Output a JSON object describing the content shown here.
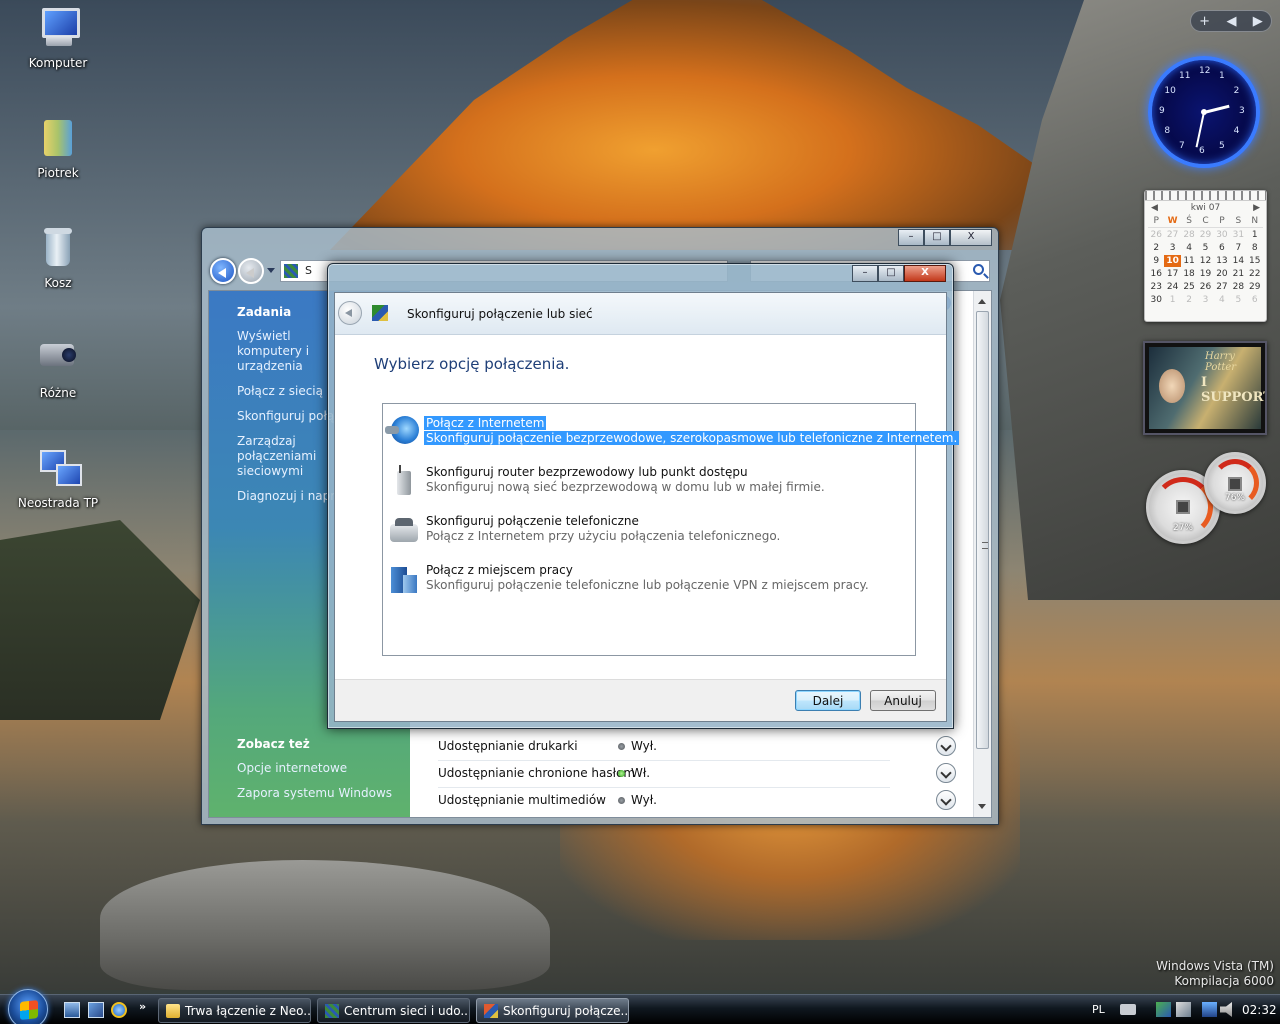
{
  "desktop": {
    "icons": [
      {
        "label": "Komputer",
        "icon": "computer-icon"
      },
      {
        "label": "Piotrek",
        "icon": "user-folder-icon"
      },
      {
        "label": "Kosz",
        "icon": "recycle-bin-icon"
      },
      {
        "label": "Różne",
        "icon": "camcorder-icon"
      },
      {
        "label": "Neostrada TP",
        "icon": "network-connection-icon"
      }
    ],
    "watermark": {
      "line1": "Windows Vista (TM)",
      "line2": "Kompilacja 6000"
    }
  },
  "sidebar": {
    "controls": {
      "add": "+",
      "prev": "◀",
      "next": "▶"
    },
    "clock": {
      "hour": 2,
      "minute": 32,
      "numbers": [
        "12",
        "1",
        "2",
        "3",
        "4",
        "5",
        "6",
        "7",
        "8",
        "9",
        "10",
        "11"
      ]
    },
    "calendar": {
      "month": "kwi 07",
      "weekdays": [
        "P",
        "W",
        "Ś",
        "C",
        "P",
        "S",
        "N"
      ],
      "days": [
        {
          "d": "26",
          "dim": true
        },
        {
          "d": "27",
          "dim": true
        },
        {
          "d": "28",
          "dim": true
        },
        {
          "d": "29",
          "dim": true
        },
        {
          "d": "30",
          "dim": true
        },
        {
          "d": "31",
          "dim": true
        },
        {
          "d": "1"
        },
        {
          "d": "2"
        },
        {
          "d": "3"
        },
        {
          "d": "4"
        },
        {
          "d": "5"
        },
        {
          "d": "6"
        },
        {
          "d": "7"
        },
        {
          "d": "8"
        },
        {
          "d": "9"
        },
        {
          "d": "10",
          "today": true
        },
        {
          "d": "11"
        },
        {
          "d": "12"
        },
        {
          "d": "13"
        },
        {
          "d": "14"
        },
        {
          "d": "15"
        },
        {
          "d": "16"
        },
        {
          "d": "17"
        },
        {
          "d": "18"
        },
        {
          "d": "19"
        },
        {
          "d": "20"
        },
        {
          "d": "21"
        },
        {
          "d": "22"
        },
        {
          "d": "23"
        },
        {
          "d": "24"
        },
        {
          "d": "25"
        },
        {
          "d": "26"
        },
        {
          "d": "27"
        },
        {
          "d": "28"
        },
        {
          "d": "29"
        },
        {
          "d": "30"
        },
        {
          "d": "1",
          "dim": true
        },
        {
          "d": "2",
          "dim": true
        },
        {
          "d": "3",
          "dim": true
        },
        {
          "d": "4",
          "dim": true
        },
        {
          "d": "5",
          "dim": true
        },
        {
          "d": "6",
          "dim": true
        }
      ]
    },
    "slideshow": {
      "text1": "Harry Potter",
      "text2": "I SUPPORT"
    },
    "cpu_meter": {
      "cpu": "27%",
      "memory": "76%"
    }
  },
  "back_window": {
    "address": "S",
    "tasks_header": "Zadania",
    "tasks": [
      "Wyświetl komputery i urządzenia",
      "Połącz z siecią",
      "Skonfiguruj połączenie",
      "Zarządzaj połączeniami sieciowymi",
      "Diagnozuj i napraw"
    ],
    "see_also_header": "Zobacz też",
    "see_also": [
      "Opcje internetowe",
      "Zapora systemu Windows"
    ],
    "sharing": [
      {
        "name": "Udostępnianie drukarki",
        "status": "Wył.",
        "on": false
      },
      {
        "name": "Udostępnianie chronione hasłem",
        "status": "Wł.",
        "on": true
      },
      {
        "name": "Udostępnianie multimediów",
        "status": "Wył.",
        "on": false
      }
    ],
    "help": "?"
  },
  "dialog": {
    "title": "Skonfiguruj połączenie lub sieć",
    "heading": "Wybierz opcję połączenia.",
    "options": [
      {
        "title": "Połącz z Internetem",
        "desc": "Skonfiguruj połączenie bezprzewodowe, szerokopasmowe lub telefoniczne z Internetem.",
        "icon": "globe-icon",
        "selected": true
      },
      {
        "title": "Skonfiguruj router bezprzewodowy lub punkt dostępu",
        "desc": "Skonfiguruj nową sieć bezprzewodową w domu lub w małej firmie.",
        "icon": "router-icon",
        "selected": false
      },
      {
        "title": "Skonfiguruj połączenie telefoniczne",
        "desc": "Połącz z Internetem przy użyciu połączenia telefonicznego.",
        "icon": "phone-icon",
        "selected": false
      },
      {
        "title": "Połącz z miejscem pracy",
        "desc": "Skonfiguruj połączenie telefoniczne lub połączenie VPN z miejscem pracy.",
        "icon": "workplace-icon",
        "selected": false
      }
    ],
    "next_label": "Dalej",
    "cancel_label": "Anuluj",
    "caption": {
      "minimize": "–",
      "maximize": "□",
      "close": "X"
    }
  },
  "taskbar": {
    "quick_more": "»",
    "tasks": [
      {
        "label": "Trwa łączenie z Neo...",
        "icon": "folder-icon",
        "active": false
      },
      {
        "label": "Centrum sieci i udo...",
        "icon": "network-center-icon",
        "active": false
      },
      {
        "label": "Skonfiguruj połącze...",
        "icon": "connection-wizard-icon",
        "active": true
      }
    ],
    "tray": {
      "language": "PL",
      "time": "02:32"
    }
  }
}
